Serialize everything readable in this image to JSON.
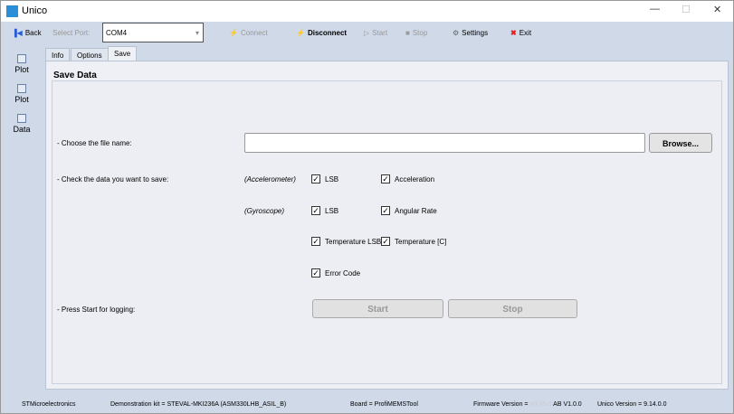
{
  "window": {
    "title": "Unico",
    "minimize": "—",
    "maximize": "☐",
    "close": "✕"
  },
  "toolbar": {
    "back": "Back",
    "select_port": "Select Port:",
    "port_value": "COM4",
    "connect": "Connect",
    "disconnect": "Disconnect",
    "start": "Start",
    "stop": "Stop",
    "settings": "Settings",
    "exit": "Exit"
  },
  "sidebar": {
    "items": [
      {
        "label": "Plot"
      },
      {
        "label": "Plot"
      },
      {
        "label": "Data"
      }
    ]
  },
  "tabs": [
    {
      "label": "Info"
    },
    {
      "label": "Options"
    },
    {
      "label": "Save"
    }
  ],
  "save": {
    "heading": "Save Data",
    "choose_file": "- Choose the file name:",
    "file_value": "",
    "browse": "Browse...",
    "check_data": "- Check the data you want to save:",
    "accelerometer": "(Accelerometer)",
    "gyroscope": "(Gyroscope)",
    "checks": {
      "acc_lsb": "LSB",
      "acceleration": "Acceleration",
      "gyro_lsb": "LSB",
      "angular_rate": "Angular Rate",
      "temp_lsb": "Temperature LSB",
      "temp_c": "Temperature [C]",
      "error_code": "Error Code"
    },
    "press_start": "- Press Start for logging:",
    "start": "Start",
    "stop": "Stop"
  },
  "status": {
    "vendor": "STMicroelectronics",
    "kit": "Demonstration kit = STEVAL-MKI236A (ASM330LHB_ASIL_B)",
    "board": "Board = ProfiMEMSTool",
    "firmware_label": "Firmware Version =",
    "firmware_hidden": "V3.45.0",
    "firmware_rest": "AB V1.0.0",
    "unico": "Unico Version = 9.14.0.0"
  }
}
